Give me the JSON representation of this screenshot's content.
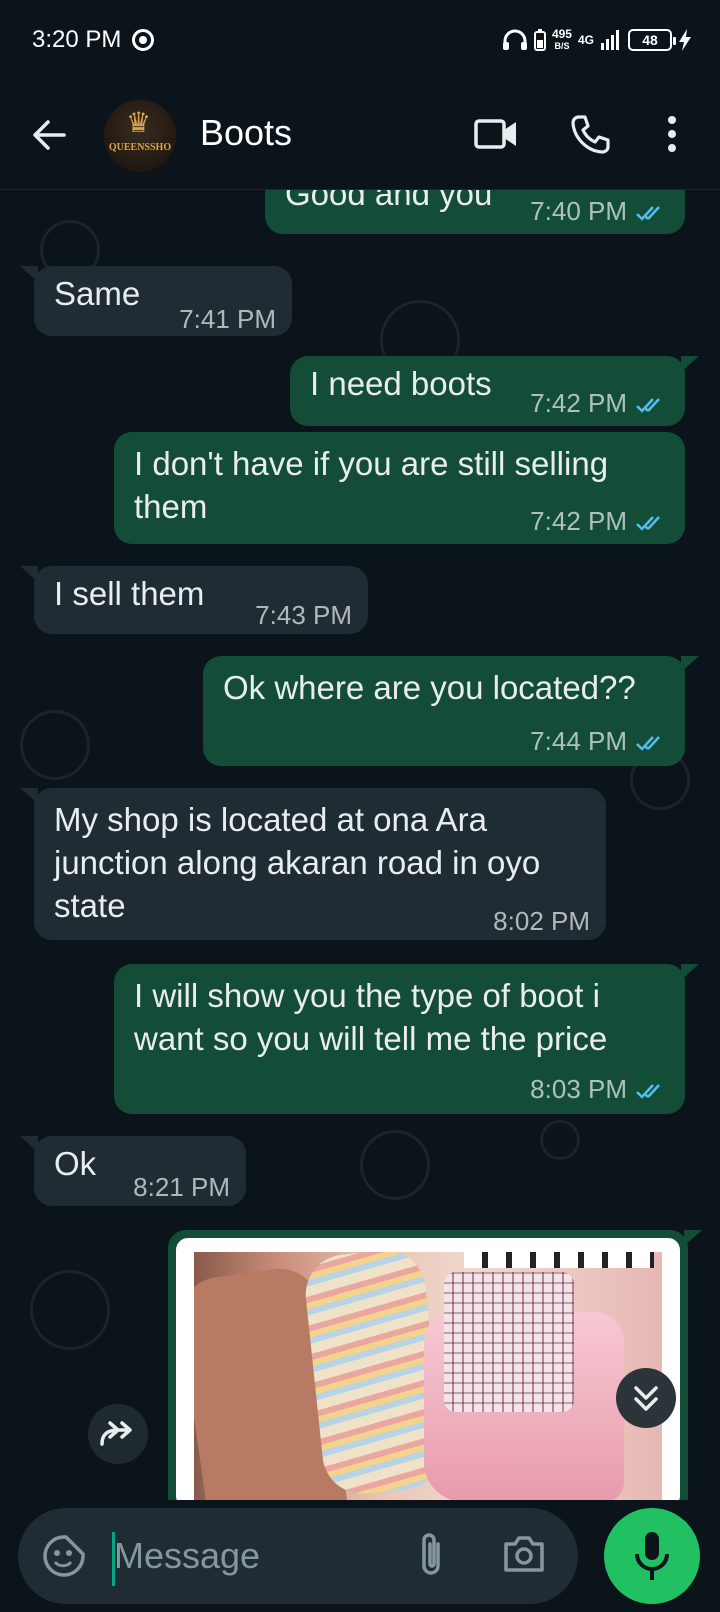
{
  "status_bar": {
    "time": "3:20 PM",
    "data_rate": "495",
    "data_rate_unit": "B/S",
    "network": "4G",
    "battery": "48"
  },
  "header": {
    "title": "Boots",
    "avatar_text": "QUEENSSHO"
  },
  "messages": [
    {
      "dir": "out",
      "text": "Good and you",
      "time": "7:40 PM"
    },
    {
      "dir": "in",
      "text": "Same",
      "time": "7:41 PM"
    },
    {
      "dir": "out",
      "text": "I need boots",
      "time": "7:42 PM"
    },
    {
      "dir": "out",
      "text": "I don't have if you are still selling them",
      "time": "7:42 PM"
    },
    {
      "dir": "in",
      "text": "I sell them",
      "time": "7:43 PM"
    },
    {
      "dir": "out",
      "text": "Ok where are you located??",
      "time": "7:44 PM"
    },
    {
      "dir": "in",
      "text": "My shop is located at ona Ara junction along akaran road in oyo state",
      "time": "8:02 PM"
    },
    {
      "dir": "out",
      "text": "I will show you the type of boot i want so you will tell me the price",
      "time": "8:03 PM"
    },
    {
      "dir": "in",
      "text": "Ok",
      "time": "8:21 PM"
    }
  ],
  "composer": {
    "placeholder": "Message"
  },
  "icons": {
    "back": "back-arrow-icon",
    "video": "video-call-icon",
    "call": "phone-icon",
    "menu": "more-vert-icon",
    "emoji": "sticker-icon",
    "attach": "paperclip-icon",
    "camera": "camera-icon",
    "mic": "mic-icon",
    "scroll": "double-chevron-down-icon",
    "forward": "forward-icon"
  },
  "colors": {
    "background": "#0b141a",
    "outgoing_bubble": "#144d37",
    "incoming_bubble": "#202c33",
    "read_ticks": "#53bdeb",
    "accent": "#21c063"
  }
}
